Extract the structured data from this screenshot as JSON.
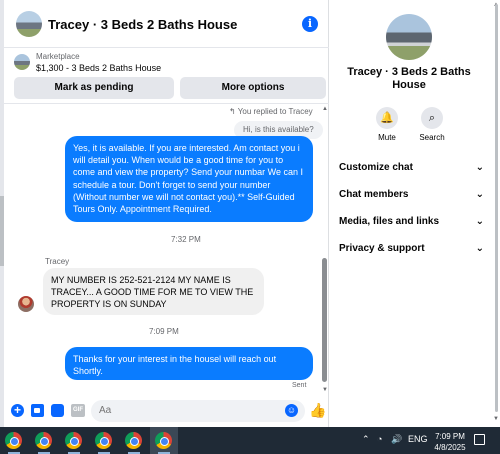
{
  "chat": {
    "title": "Tracey · 3 Beds 2 Baths House",
    "listing": {
      "category": "Marketplace",
      "text": "$1,300 - 3 Beds 2 Baths House",
      "pending_label": "Mark as pending",
      "more_label": "More options"
    },
    "messages": {
      "replied_note": "You replied to Tracey",
      "quoted": "Hi, is this available?",
      "out1": "Yes, it is available. If you are interested.  Am contact you i will detail you.  When would be a good time for you to come and view the property? Send your numbar We can I schedule a tour.  Don't forget to send your number (Without number we will not contact you).** Self-Guided Tours Only. Appointment Required.",
      "time1": "7:32 PM",
      "sender": "Tracey",
      "in1": "MY NUMBER IS 252-521-2124 MY NAME IS TRACEY... A GOOD TIME FOR ME TO VIEW THE PROPERTY IS ON SUNDAY",
      "time2": "7:09 PM",
      "out2": "Thanks for your interest in the housel will reach out Shortly.",
      "status": "Sent"
    },
    "composer": {
      "placeholder": "Aa",
      "gif_label": "GIF"
    }
  },
  "panel": {
    "title": "Tracey · 3 Beds 2 Baths House",
    "actions": [
      {
        "label": "Mute",
        "icon": "bell-icon"
      },
      {
        "label": "Search",
        "icon": "search-icon"
      }
    ],
    "sections": [
      {
        "label": "Customize chat"
      },
      {
        "label": "Chat members"
      },
      {
        "label": "Media, files and links"
      },
      {
        "label": "Privacy & support"
      }
    ]
  },
  "taskbar": {
    "lang": "ENG",
    "time": "7:09 PM",
    "date": "4/8/2025"
  },
  "colors": {
    "accent": "#0866ff",
    "outgoing_bubble": "#0a7cff",
    "taskbar": "#1f2a36"
  }
}
